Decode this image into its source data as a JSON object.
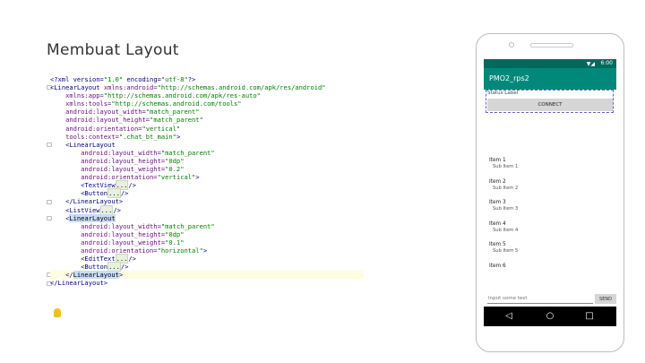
{
  "slide": {
    "title": "Membuat Layout"
  },
  "code": {
    "lines": [
      [
        {
          "t": "<?xml version=",
          "c": "tag"
        },
        {
          "t": "\"1.0\"",
          "c": "val"
        },
        {
          "t": " encoding=",
          "c": "tag"
        },
        {
          "t": "\"utf-8\"",
          "c": "val"
        },
        {
          "t": "?>",
          "c": "tag"
        }
      ],
      [
        {
          "t": "<",
          "c": "tag"
        },
        {
          "t": "LinearLayout ",
          "c": "tag"
        },
        {
          "t": "xmlns:android=",
          "c": "attr"
        },
        {
          "t": "\"http://schemas.android.com/apk/res/android\"",
          "c": "val"
        }
      ],
      [
        {
          "t": "    xmlns:app=",
          "c": "attr"
        },
        {
          "t": "\"http://schemas.android.com/apk/res-auto\"",
          "c": "val"
        }
      ],
      [
        {
          "t": "    xmlns:tools=",
          "c": "attr"
        },
        {
          "t": "\"http://schemas.android.com/tools\"",
          "c": "val"
        }
      ],
      [
        {
          "t": "    android:layout_width=",
          "c": "attr"
        },
        {
          "t": "\"match_parent\"",
          "c": "val"
        }
      ],
      [
        {
          "t": "    android:layout_height=",
          "c": "attr"
        },
        {
          "t": "\"match_parent\"",
          "c": "val"
        }
      ],
      [
        {
          "t": "    android:orientation=",
          "c": "attr"
        },
        {
          "t": "\"vertical\"",
          "c": "val"
        }
      ],
      [
        {
          "t": "    tools:context=",
          "c": "attr"
        },
        {
          "t": "\".chat_bt_main\"",
          "c": "val"
        },
        {
          "t": ">",
          "c": "tag"
        }
      ],
      [
        {
          "t": "    <LinearLayout",
          "c": "tag"
        }
      ],
      [
        {
          "t": "        android:layout_width=",
          "c": "attr"
        },
        {
          "t": "\"match_parent\"",
          "c": "val"
        }
      ],
      [
        {
          "t": "        android:layout_height=",
          "c": "attr"
        },
        {
          "t": "\"0dp\"",
          "c": "val"
        }
      ],
      [
        {
          "t": "        android:layout_weight=",
          "c": "attr"
        },
        {
          "t": "\"0.2\"",
          "c": "val"
        }
      ],
      [
        {
          "t": "        android:orientation=",
          "c": "attr"
        },
        {
          "t": "\"vertical\"",
          "c": "val"
        },
        {
          "t": ">",
          "c": "tag"
        }
      ],
      [
        {
          "t": "        <TextView",
          "c": "tag"
        },
        {
          "t": "...",
          "c": "fold"
        },
        {
          "t": "/>",
          "c": "tag"
        }
      ],
      [
        {
          "t": "        <Button",
          "c": "tag"
        },
        {
          "t": "...",
          "c": "fold"
        },
        {
          "t": "/>",
          "c": "tag"
        }
      ],
      [
        {
          "t": "    </LinearLayout>",
          "c": "tag"
        }
      ],
      [
        {
          "t": "    <ListView",
          "c": "tag"
        },
        {
          "t": "...",
          "c": "fold"
        },
        {
          "t": "/>",
          "c": "tag"
        }
      ],
      [
        {
          "t": "    <",
          "c": "tag"
        },
        {
          "t": "LinearLayout",
          "c": "sel"
        }
      ],
      [
        {
          "t": "        android:layout_width=",
          "c": "attr"
        },
        {
          "t": "\"match_parent\"",
          "c": "val"
        }
      ],
      [
        {
          "t": "        android:layout_height=",
          "c": "attr"
        },
        {
          "t": "\"0dp\"",
          "c": "val"
        }
      ],
      [
        {
          "t": "        android:layout_weight=",
          "c": "attr"
        },
        {
          "t": "\"0.1\"",
          "c": "val"
        }
      ],
      [
        {
          "t": "        android:orientation=",
          "c": "attr"
        },
        {
          "t": "\"horizontal\"",
          "c": "val"
        },
        {
          "t": ">",
          "c": "tag"
        }
      ],
      [
        {
          "t": "        <EditText",
          "c": "tag"
        },
        {
          "t": "...",
          "c": "fold"
        },
        {
          "t": "/>",
          "c": "tag"
        }
      ],
      [
        {
          "t": "        <Button",
          "c": "tag"
        },
        {
          "t": "...",
          "c": "fold"
        },
        {
          "t": "/>",
          "c": "tag"
        }
      ],
      [
        {
          "t": "    </",
          "c": "tag"
        },
        {
          "t": "LinearLayout",
          "c": "sel"
        },
        {
          "t": ">",
          "c": "tag"
        }
      ],
      [
        {
          "t": "</LinearLayout>",
          "c": "tag"
        }
      ]
    ]
  },
  "phone": {
    "status_time": "6:00",
    "status_icons": "▼◢",
    "app_title": "PMO2_rps2",
    "status_label": "Status Label",
    "connect_label": "CONNECT",
    "list_items": [
      {
        "title": "Item 1",
        "sub": "Sub Item 1"
      },
      {
        "title": "Item 2",
        "sub": "Sub Item 2"
      },
      {
        "title": "Item 3",
        "sub": "Sub Item 3"
      },
      {
        "title": "Item 4",
        "sub": "Sub Item 4"
      },
      {
        "title": "Item 5",
        "sub": "Sub Item 5"
      },
      {
        "title": "Item 6",
        "sub": ""
      }
    ],
    "input_placeholder": "Input some text",
    "send_label": "SEND",
    "nav": {
      "back": "◁",
      "home": "○",
      "recents": "□"
    }
  }
}
